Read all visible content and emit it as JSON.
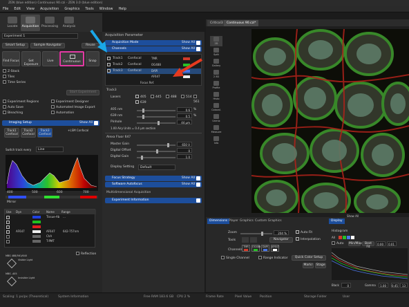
{
  "window": {
    "title": "ZEN (blue edition) Continuous 90.czi - ZEN 3.0 (blue edition)"
  },
  "menu": [
    "File",
    "Edit",
    "View",
    "Acquisition",
    "Graphics",
    "Tools",
    "Window",
    "Help"
  ],
  "left_tabs": [
    {
      "label": "Locate"
    },
    {
      "label": "Acquisition"
    },
    {
      "label": "Processing"
    },
    {
      "label": "Analysis"
    }
  ],
  "experiment": {
    "combo": "Experiment 1",
    "smart_setup": "Smart Setup",
    "sample_navigator": "Sample Navigator",
    "reuse": "Reuse"
  },
  "action_buttons": {
    "find_focus": "Find Focus",
    "set_exposure": "Set Exposure",
    "live": "Live",
    "continuous": "Continuous",
    "snap": "Snap"
  },
  "dimension_toggles": [
    "Z-Stack",
    "Tiles",
    "Time Series"
  ],
  "start_experiment": "Start Experiment",
  "options": {
    "left": [
      "Experiment Regions",
      "Auto Save",
      "Bleaching"
    ],
    "right": [
      "Experiment Designer",
      "Automated Image Export",
      "Automation"
    ]
  },
  "imaging_setup": {
    "title": "Imaging Setup",
    "show_all": "Show All",
    "tracks": [
      "Track1",
      "Track2",
      "Track3"
    ],
    "track_mode": "Confocal",
    "lsm_confocal": "+LSM Confocal",
    "switch_label": "Switch track every",
    "switch_value": "Line",
    "spectrum_ticks": [
      "400",
      "500",
      "600",
      "700"
    ]
  },
  "mirror": "Mirror",
  "dye_table": {
    "headers": [
      "Use",
      "Dye",
      "Color",
      "Name",
      "Range"
    ],
    "rows": [
      {
        "dye": "",
        "name": "Tissue-Ab",
        "range": "…"
      },
      {
        "dye": "",
        "name": "",
        "range": ""
      },
      {
        "dye": "",
        "name": "",
        "range": ""
      },
      {
        "dye": "AF647",
        "name": "AF647",
        "range": "642-757nm"
      },
      {
        "dye": "",
        "name": "ChA",
        "range": ""
      },
      {
        "dye": "",
        "name": "T-PMT",
        "range": ""
      }
    ]
  },
  "reflection": "Reflection",
  "light_paths": [
    {
      "label": "MBS 488/561/640",
      "sub": "Visible Light"
    },
    {
      "label": "MBS -405",
      "sub": "Invisible Light"
    }
  ],
  "acq_param": {
    "title": "Acquisition Parameter",
    "acq_mode": "Acquisition Mode",
    "channels": "Channels",
    "show_all": "Show All",
    "tracks": [
      {
        "name": "Track1",
        "mode": "Confocal",
        "ch": "TMR",
        "color": "#d23b2b"
      },
      {
        "name": "Track2",
        "mode": "Confocal",
        "ch": "OG488",
        "color": "#27c027"
      },
      {
        "name": "Track3",
        "mode": "Confocal",
        "ch": "DAPI",
        "color": "#4a76e6"
      }
    ],
    "extra_ch": "AF647",
    "focus_ref": "Focus Ref.",
    "track_heading": "Track3",
    "lasers_label": "Lasers",
    "lasers": [
      "405",
      "445",
      "488",
      "514",
      "561",
      "639"
    ],
    "laser405_label": "405 nm",
    "laser405_val": "0.6",
    "laser639_label": "639 nm",
    "laser639_val": "0.5",
    "unit_pct": "%",
    "pinhole_label": "Pinhole",
    "pinhole_val": "44 µm",
    "airy": "1.00 Airy Units = 0.4 µm section",
    "alexa_heading": "Alexa Fluor 647",
    "master_gain_label": "Master Gain",
    "master_gain_val": "650 V",
    "digital_offset_label": "Digital Offset",
    "digital_offset_val": "0",
    "digital_gain_label": "Digital Gain",
    "digital_gain_val": "1.0",
    "display_label": "Display Setting",
    "display_val": "Default",
    "focus_strategy": "Focus Strategy",
    "software_autofocus": "Software Autofocus",
    "multidim": "Multidimensional Acquisition",
    "exp_info": "Experiment Information"
  },
  "doc_tabs": [
    "CritIcal3",
    "Continuous 90.czi*"
  ],
  "side_tools": [
    "2D",
    "Split",
    "Gallery",
    "2.5D",
    "Profile",
    "Histo",
    "Colocal.",
    "Unmix",
    "Measure",
    "Info"
  ],
  "view_tabs": [
    "Dimensions",
    "Player",
    "Graphics",
    "Custom Graphics"
  ],
  "display_tab": "Display",
  "zoom": {
    "label": "Zoom",
    "value": "204 %",
    "auto_fit": "Auto Fit",
    "interp": "Interpolation"
  },
  "tools_label": "Tools",
  "navigator": "Navigator",
  "channels_label": "Channels",
  "channel_chips": [
    {
      "name": "TMR",
      "color": "#d23b2b"
    },
    {
      "name": "OG488",
      "color": "#27c027"
    },
    {
      "name": "DAPI",
      "color": "#4a76e6"
    },
    {
      "name": "AF647",
      "color": "#ffffff"
    }
  ],
  "single_channel": "Single Channel",
  "range_indicator": "Range Indicator",
  "quick_color": "Quick Color Setup",
  "markers": "Markr",
  "stage": "Stage",
  "histogram": {
    "title": "Histogram",
    "all": "All",
    "auto": "Auto",
    "minmax": "Min/Max",
    "bestfit": "Best Fit",
    "v1": "0.00",
    "v2": "0.01",
    "black_label": "Black",
    "black_val": "0",
    "gamma_label": "Gamma",
    "gamma_val": "1.00",
    "white_val": "0.45",
    "right_val": "13"
  },
  "show_all_small": "Show All",
  "status": [
    "Scaling: 1 px/px (Theoretical)",
    "System Information",
    "Free RAM 183.6 GB",
    "CPU 2 %",
    "Frame Rate",
    "Pixel Value",
    "Position",
    "Storage Folder",
    "User"
  ]
}
